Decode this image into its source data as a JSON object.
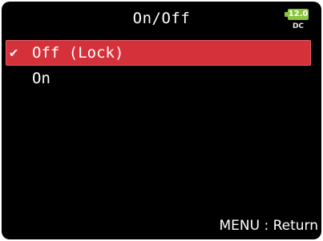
{
  "header": {
    "title": "On/Off"
  },
  "status": {
    "battery_voltage": "12.0",
    "power_source": "DC",
    "battery_icon": "battery-icon",
    "battery_color": "#8ac43f"
  },
  "menu": {
    "selected_color": "#d5313a",
    "check_icon": "checkmark-icon",
    "items": [
      {
        "label": "Off (Lock)",
        "selected": true
      },
      {
        "label": "On",
        "selected": false
      }
    ]
  },
  "footer": {
    "hint": "MENU : Return"
  }
}
